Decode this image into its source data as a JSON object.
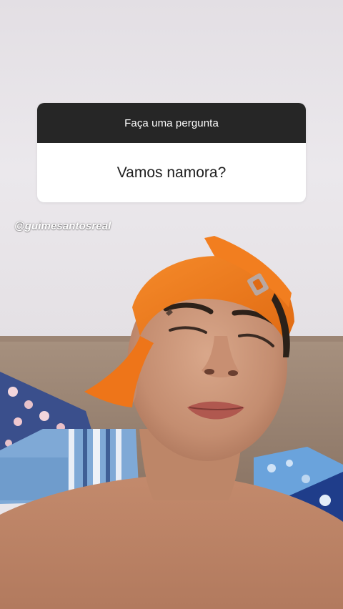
{
  "story": {
    "question_sticker": {
      "prompt": "Faça uma pergunta",
      "answer": "Vamos namora?"
    },
    "mention": "@guimesantosreal"
  },
  "colors": {
    "sticker_header": "#262626",
    "sticker_body": "#ffffff",
    "wall": "#e9e6ea",
    "cap": "#f07a1e"
  }
}
